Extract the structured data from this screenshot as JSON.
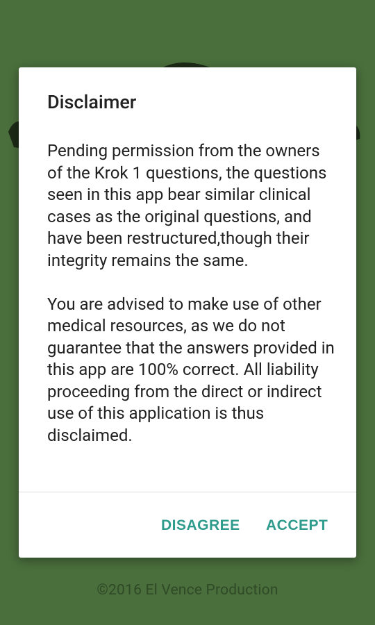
{
  "dialog": {
    "title": "Disclaimer",
    "paragraphs": [
      "Pending permission from the owners of the Krok 1 questions, the questions seen in this app bear similar clinical cases as the original questions, and have been restructured,though their integrity remains the same.",
      "You are advised to make use of other medical resources, as we do not guarantee that the answers provided in this app are 100% correct. All liability proceeding from the direct or indirect use of this application is thus disclaimed."
    ],
    "disagree_label": "DISAGREE",
    "accept_label": "ACCEPT"
  },
  "footer": {
    "copyright": "©2016 El Vence Production"
  },
  "colors": {
    "background": "#4a6e3c",
    "accent": "#2e9b8d",
    "dialog": "#ffffff"
  }
}
